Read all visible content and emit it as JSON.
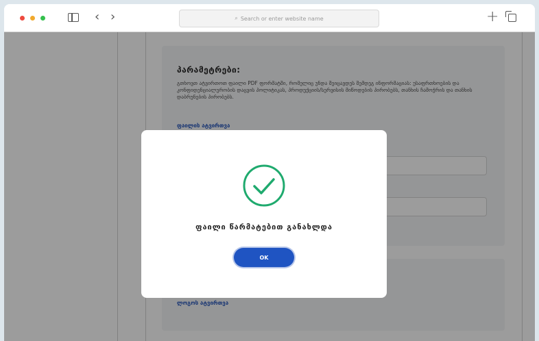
{
  "browser": {
    "url_placeholder": "Search or enter website name"
  },
  "page": {
    "section_title": "პარამეტრები:",
    "section_desc": "გთხოვთ ატვირთოთ ფაილი PDF ფორმატში, რომელიც უნდა შეიცავდეს შემდეგ ინფორმაციას: უსაფრთხოების და კონფიდენციალურობის დაცვის პოლიტიკას, პროდუქციის/სერვისის მიწოდების პირობებს, თანხის ჩამოჭრის და თანხის დაბრუნების პირობებს.",
    "file_upload_link": "ფაილის ატვირთვა",
    "logo_upload_link": "ლოგოს ატვირთვა"
  },
  "modal": {
    "message": "ფაილი წარმატებით განახლდა",
    "ok_label": "OK"
  },
  "colors": {
    "accent": "#1f54c2",
    "success": "#1faa6e"
  }
}
